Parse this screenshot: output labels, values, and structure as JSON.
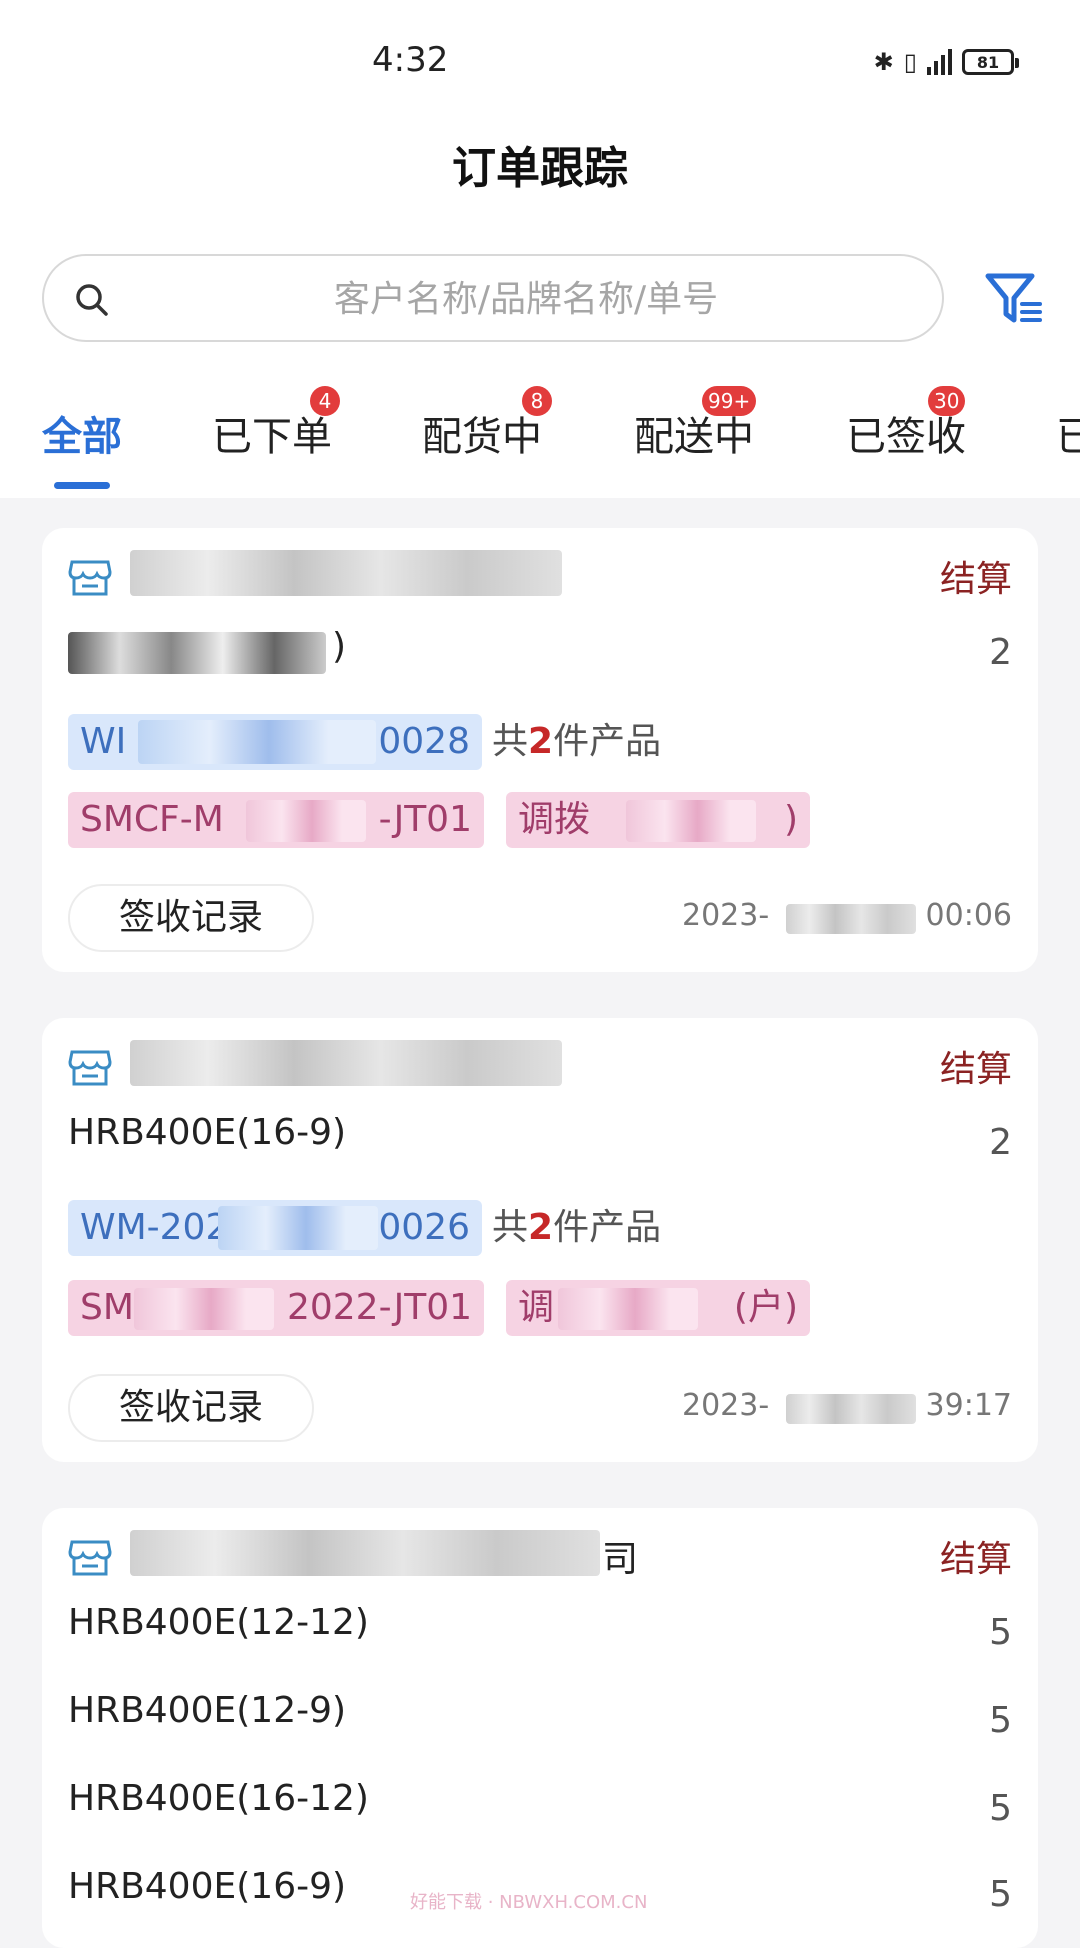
{
  "status_bar": {
    "time": "4:32",
    "battery": "81"
  },
  "header": {
    "title": "订单跟踪"
  },
  "search": {
    "placeholder": "客户名称/品牌名称/单号"
  },
  "tabs": [
    {
      "label": "全部",
      "badge": "",
      "active": true
    },
    {
      "label": "已下单",
      "badge": "4"
    },
    {
      "label": "配货中",
      "badge": "8"
    },
    {
      "label": "配送中",
      "badge": "99+"
    },
    {
      "label": "已签收",
      "badge": "30"
    },
    {
      "label": "已"
    }
  ],
  "orders": [
    {
      "company_suffix": "",
      "settle_label": "结算",
      "products": [
        {
          "name": ")",
          "qty": "2"
        }
      ],
      "order_no_visible": "0028",
      "order_no_prefix": "WI",
      "count_prefix": "共",
      "count": "2",
      "count_suffix": "件产品",
      "contract_prefix": "SMCF-M",
      "contract_suffix": "-JT01",
      "transfer_prefix": "调拨",
      "transfer_suffix": ")",
      "sign_label": "签收记录",
      "time_prefix": "2023-",
      "time_suffix": "00:06"
    },
    {
      "company_suffix": "",
      "settle_label": "结算",
      "products": [
        {
          "name": "HRB400E(16-9)",
          "qty": "2"
        }
      ],
      "order_no_prefix": "WM-202",
      "order_no_visible": "0026",
      "count_prefix": "共",
      "count": "2",
      "count_suffix": "件产品",
      "contract_prefix": "SM",
      "contract_suffix": "2022-JT01",
      "transfer_prefix": "调",
      "transfer_suffix": "(户)",
      "sign_label": "签收记录",
      "time_prefix": "2023-",
      "time_suffix": "39:17"
    },
    {
      "company_suffix": "司",
      "settle_label": "结算",
      "products": [
        {
          "name": "HRB400E(12-12)",
          "qty": "5"
        },
        {
          "name": "HRB400E(12-9)",
          "qty": "5"
        },
        {
          "name": "HRB400E(16-12)",
          "qty": "5"
        },
        {
          "name": "HRB400E(16-9)",
          "qty": "5"
        }
      ]
    }
  ],
  "watermark": "好能下载 · NBWXH.COM.CN",
  "colors": {
    "accent": "#2a6fd6",
    "badge": "#e23c3c",
    "settle": "#8b2323",
    "tag_blue": "#d9e7fb",
    "tag_pink": "#f6d3e3"
  }
}
